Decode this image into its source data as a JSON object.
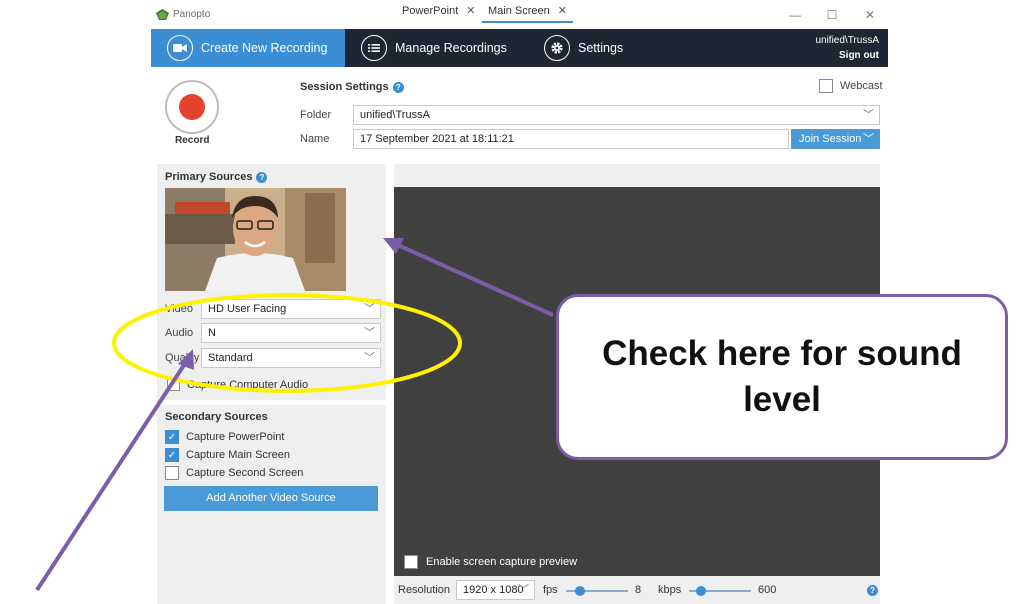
{
  "app": {
    "title": "Panopto"
  },
  "window_controls": {
    "minimize": "—",
    "maximize": "☐",
    "close": "✕"
  },
  "nav": {
    "tabs": [
      {
        "label": "Create New Recording",
        "icon": "video-camera-icon",
        "active": true
      },
      {
        "label": "Manage Recordings",
        "icon": "list-icon",
        "active": false
      },
      {
        "label": "Settings",
        "icon": "gear-icon",
        "active": false
      }
    ],
    "user": "unified\\TrussA",
    "sign_out": "Sign out"
  },
  "record": {
    "label": "Record"
  },
  "session_settings": {
    "title": "Session Settings",
    "webcast_label": "Webcast",
    "webcast_checked": false,
    "folder_label": "Folder",
    "folder_value": "unified\\TrussA",
    "name_label": "Name",
    "name_value": "17 September 2021 at 18:11:21",
    "join_session": "Join Session"
  },
  "primary_sources": {
    "title": "Primary Sources",
    "video_label": "Video",
    "video_value": "HD User Facing",
    "audio_label": "Audio",
    "audio_value": "N",
    "quality_label": "Quality",
    "quality_value": "Standard",
    "capture_audio_label": "Capture Computer Audio",
    "capture_audio_checked": false
  },
  "secondary_sources": {
    "title": "Secondary Sources",
    "items": [
      {
        "label": "Capture PowerPoint",
        "checked": true
      },
      {
        "label": "Capture Main Screen",
        "checked": true
      },
      {
        "label": "Capture Second Screen",
        "checked": false
      }
    ],
    "add_button": "Add Another Video Source"
  },
  "right_panel": {
    "tabs": [
      {
        "label": "PowerPoint",
        "close": "✕",
        "active": false
      },
      {
        "label": "Main Screen",
        "close": "✕",
        "active": true
      }
    ],
    "preview_label": "Enable screen capture preview",
    "preview_checked": false
  },
  "status_bar": {
    "resolution_label": "Resolution",
    "resolution_value": "1920 x 1080",
    "fps_label": "fps",
    "fps_value": "8",
    "kbps_label": "kbps",
    "kbps_value": "600"
  },
  "annotation": {
    "callout_text": "Check here for sound level",
    "ellipse_color": "#fff200",
    "arrow_color": "#7b5ea7"
  },
  "colors": {
    "accent": "#3b8ed3",
    "nav_bg": "#1f2533",
    "record": "#e5432b"
  }
}
